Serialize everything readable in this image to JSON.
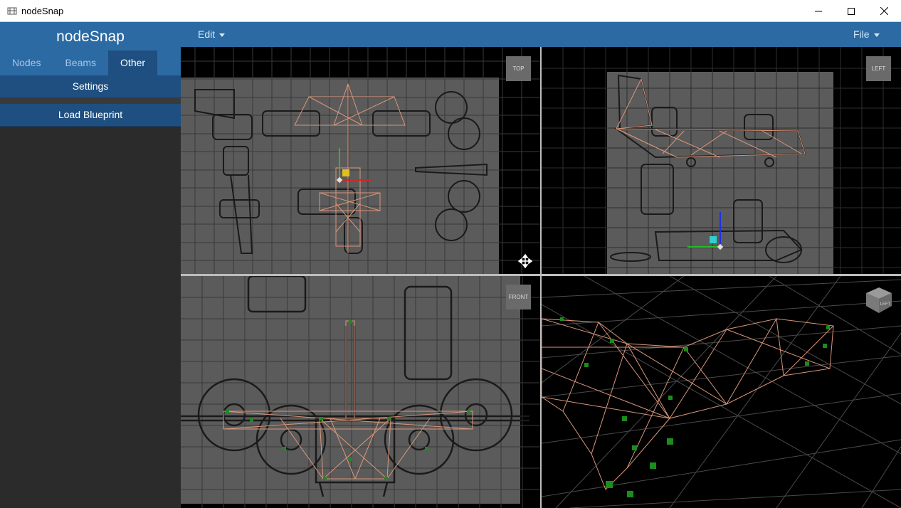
{
  "window": {
    "title": "nodeSnap"
  },
  "sidebar": {
    "brand": "nodeSnap",
    "tabs": [
      {
        "label": "Nodes",
        "active": false
      },
      {
        "label": "Beams",
        "active": false
      },
      {
        "label": "Other",
        "active": true
      }
    ],
    "buttons": {
      "settings": "Settings",
      "load_blueprint": "Load Blueprint"
    }
  },
  "menubar": {
    "edit": "Edit",
    "file": "File"
  },
  "viewports": {
    "top": {
      "label": "TOP"
    },
    "left": {
      "label": "LEFT"
    },
    "front": {
      "label": "FRONT"
    },
    "perspective": {
      "cube_label": "LEFT"
    }
  },
  "colors": {
    "accent": "#2b6aa3",
    "accent_dark": "#1e4f80",
    "wireframe": "#d9967a",
    "node": "#1c8c1c"
  },
  "icons": {
    "move": "move-icon",
    "view_cube": "view-cube-icon"
  }
}
